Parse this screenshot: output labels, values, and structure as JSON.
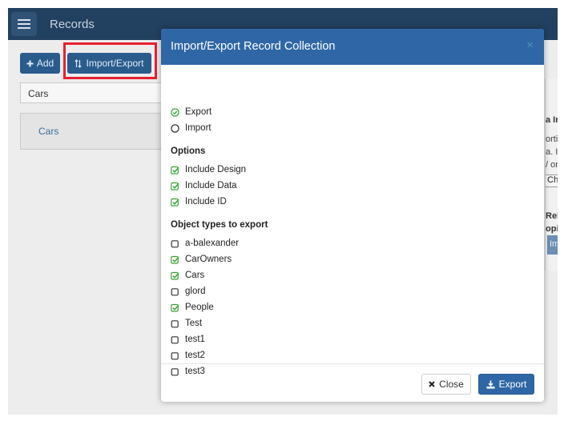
{
  "app": {
    "title": "Records",
    "add_label": "Add",
    "import_export_label": "Import/Export",
    "filter_value": "Cars",
    "list_items": [
      "Cars"
    ],
    "right_fragments": [
      "a In",
      "orti",
      "a. In",
      "/ or",
      "Cho",
      "Rel",
      "opin",
      "Im"
    ]
  },
  "modal": {
    "title": "Import/Export Record Collection",
    "close_glyph": "×",
    "mode_options": [
      {
        "label": "Export",
        "selected": true
      },
      {
        "label": "Import",
        "selected": false
      }
    ],
    "options_heading": "Options",
    "options": [
      {
        "label": "Include Design",
        "checked": true
      },
      {
        "label": "Include Data",
        "checked": true
      },
      {
        "label": "Include ID",
        "checked": true
      }
    ],
    "object_types_heading": "Object types to export",
    "object_types": [
      {
        "label": "a-balexander",
        "checked": false
      },
      {
        "label": "CarOwners",
        "checked": true
      },
      {
        "label": "Cars",
        "checked": true
      },
      {
        "label": "glord",
        "checked": false
      },
      {
        "label": "People",
        "checked": true
      },
      {
        "label": "Test",
        "checked": false
      },
      {
        "label": "test1",
        "checked": false
      },
      {
        "label": "test2",
        "checked": false
      },
      {
        "label": "test3",
        "checked": false
      }
    ],
    "close_label": "Close",
    "export_label": "Export"
  },
  "colors": {
    "header_blue": "#2f67a6",
    "topbar": "#22405f",
    "check_green": "#3aa53a",
    "highlight_red": "#e8202f"
  },
  "icons": {
    "menu": "hamburger-icon",
    "add": "plus-icon",
    "import_export": "sort-arrows-icon",
    "close": "x-icon",
    "export": "download-icon"
  }
}
